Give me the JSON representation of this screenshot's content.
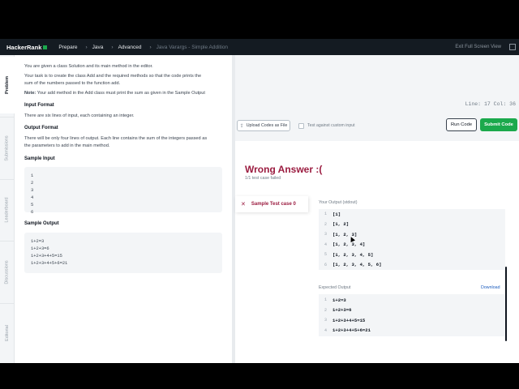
{
  "topbar": {
    "logo": "HackerRank",
    "nav": [
      "Prepare",
      "Java",
      "Advanced"
    ],
    "current": "Java Varargs - Simple Addition",
    "exit_fullscreen": "Exit Full Screen View"
  },
  "sidetabs": [
    "Problem",
    "Submissions",
    "Leaderboard",
    "Discussions",
    "Editorial"
  ],
  "problem": {
    "intro_1": "You are given a class Solution and its main method in the editor.",
    "intro_2": "Your task is to create the class Add and the required methods so that the code prints the",
    "intro_3": "sum of the numbers passed to the function add.",
    "note_label": "Note:",
    "note_text": " Your add method in the Add class must print the sum as given in the Sample Output",
    "input_format_h": "Input Format",
    "input_format": "There are six lines of input, each containing an integer.",
    "output_format_h": "Output Format",
    "output_format_1": "There will be only four lines of output. Each line contains the sum of the integers passed as",
    "output_format_2": "the parameters to add in the main method.",
    "sample_input_h": "Sample Input",
    "sample_input": [
      "1",
      "2",
      "3",
      "4",
      "5",
      "6"
    ],
    "sample_output_h": "Sample Output",
    "sample_output": [
      "1+2=3",
      "1+2+3=6",
      "1+2+3+4+5=15",
      "1+2+3+4+5+6=21"
    ]
  },
  "editor": {
    "status": "Line: 17 Col: 36",
    "upload_label": "Upload Codes as File",
    "custom_input_label": "Test against custom input",
    "run_label": "Run Code",
    "submit_label": "Submit Code",
    "accent_green": "#1ba94c"
  },
  "result": {
    "title": "Wrong Answer :(",
    "subtitle": "1/1 test case failed",
    "testcase_label": "Sample Test case 0",
    "your_output_label": "Your Output (stdout)",
    "your_output": [
      "[1]",
      "[1, 2]",
      "[1, 2, 3]",
      "[1, 2, 3, 4]",
      "[1, 2, 3, 4, 5]",
      "[1, 2, 3, 4, 5, 6]"
    ],
    "expected_label": "Expected Output",
    "download_label": "Download",
    "expected_output": [
      "1+2=3",
      "1+2+3=6",
      "1+2+3+4+5=15",
      "1+2+3+4+5+6=21"
    ],
    "error_color": "#9b1c40"
  }
}
